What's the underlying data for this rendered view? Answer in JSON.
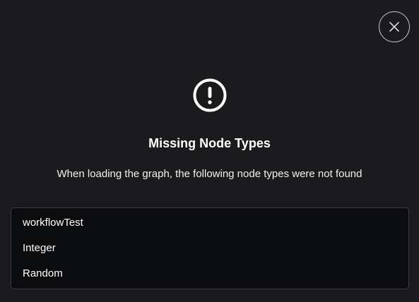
{
  "dialog": {
    "close_icon": "close-x-icon",
    "alert_icon": "exclamation-circle-icon",
    "title": "Missing Node Types",
    "message": "When loading the graph, the following node types were not found",
    "missing_node_types": [
      "workflowTest",
      "Integer",
      "Random"
    ]
  },
  "colors": {
    "background": "#1b1b1d",
    "list_background": "#0b0c0e",
    "list_border": "#3a3b3f",
    "text": "#ffffff"
  }
}
